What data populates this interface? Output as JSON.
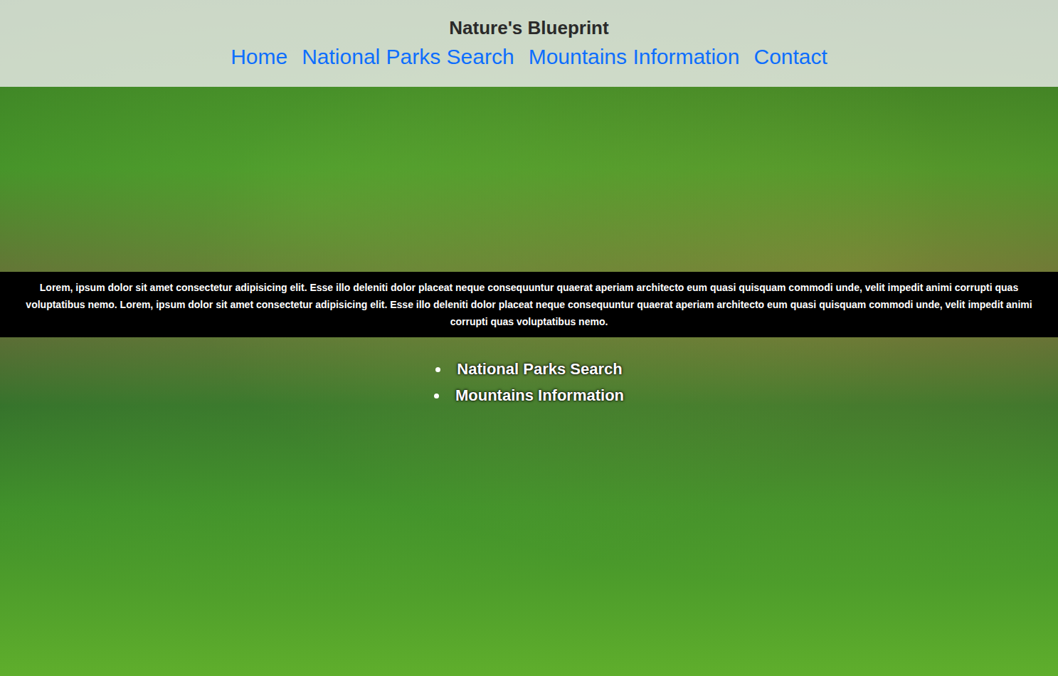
{
  "header": {
    "title": "Nature's Blueprint",
    "nav": [
      {
        "label": "Home",
        "selected": false
      },
      {
        "label": "National Parks Search",
        "selected": false
      },
      {
        "label": "Mountains Information",
        "selected": false
      },
      {
        "label": "Contact",
        "selected": false
      }
    ]
  },
  "intro": {
    "text": "Lorem, ipsum dolor sit amet consectetur adipisicing elit. Esse illo deleniti dolor placeat neque consequuntur quaerat aperiam architecto eum quasi quisquam commodi unde, velit impedit animi corrupti quas voluptatibus nemo. Lorem, ipsum dolor sit amet consectetur adipisicing elit. Esse illo deleniti dolor placeat neque consequuntur quaerat aperiam architecto eum quasi quisquam commodi unde, velit impedit animi corrupti quas voluptatibus nemo."
  },
  "links": [
    {
      "label": "National Parks Search"
    },
    {
      "label": "Mountains Information"
    }
  ]
}
